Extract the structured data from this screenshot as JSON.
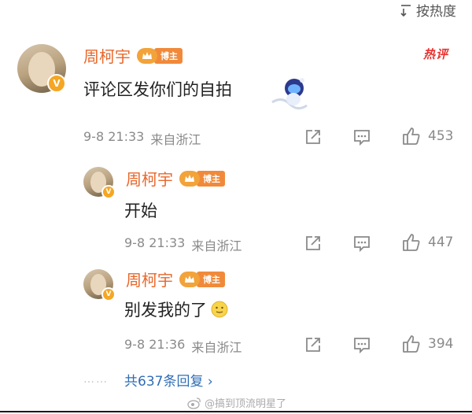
{
  "header": {
    "sort_label": "按热度"
  },
  "comments": [
    {
      "username": "周柯宇",
      "badge_label": "博主",
      "hot_tag": "热评",
      "text": "评论区发你们的自拍",
      "time": "9-8 21:33",
      "location": "来自浙江",
      "likes": "453"
    }
  ],
  "replies": [
    {
      "username": "周柯宇",
      "badge_label": "博主",
      "text": "开始",
      "time": "9-8 21:33",
      "location": "来自浙江",
      "likes": "447"
    },
    {
      "username": "周柯宇",
      "badge_label": "博主",
      "text": "别发我的了",
      "time": "9-8 21:36",
      "location": "来自浙江",
      "likes": "394"
    }
  ],
  "more_replies": "共637条回复 ›",
  "dots": "……",
  "watermark": "@搞到顶流明星了",
  "colors": {
    "name": "#e8672b",
    "link": "#2f6db5",
    "hot": "#e8322f",
    "badge": "#f08a3a"
  }
}
